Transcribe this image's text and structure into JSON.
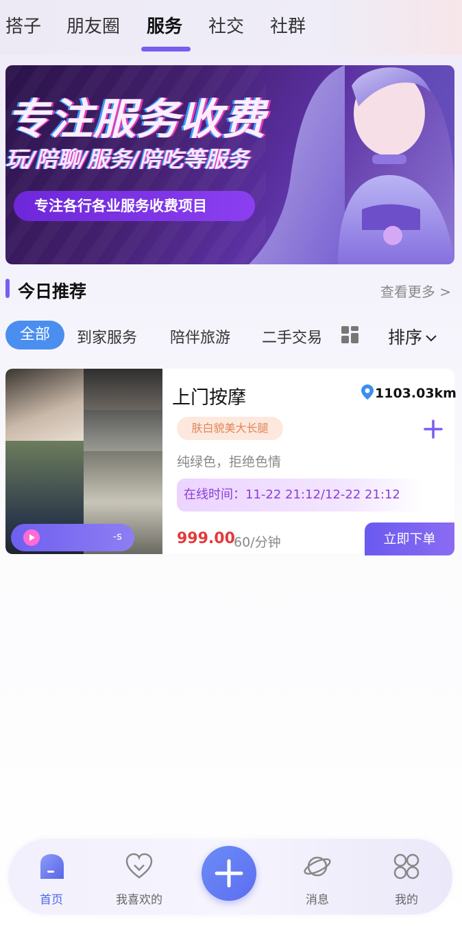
{
  "top_tabs": {
    "items": [
      {
        "label": "搭子"
      },
      {
        "label": "朋友圈"
      },
      {
        "label": "服务"
      },
      {
        "label": "社交"
      },
      {
        "label": "社群"
      }
    ],
    "active": "服务"
  },
  "banner": {
    "headline": "专注服务收费",
    "subline": "玩/陪聊/服务/陪吃等服务",
    "pill": "专注各行各业服务收费项目"
  },
  "section": {
    "title": "今日推荐",
    "see_more": "查看更多 >"
  },
  "categories": {
    "items": [
      {
        "label": "全部"
      },
      {
        "label": "到家服务"
      },
      {
        "label": "陪伴旅游"
      },
      {
        "label": "二手交易"
      }
    ],
    "active": "全部",
    "sort_label": "排序",
    "grid_icon": "grid-icon",
    "sort_icon": "chevron-down-icon"
  },
  "card": {
    "title": "上门按摩",
    "distance": "1103.03km",
    "tag": "肤白貌美大长腿",
    "description": "纯绿色，拒绝色情",
    "online_time": "在线时间：11-22 21:12/12-22 21:12",
    "price": "999.00",
    "unit": "60/分钟",
    "order_button": "立即下单",
    "audio_length": "-s"
  },
  "bottom_nav": {
    "items": [
      {
        "label": "首页",
        "icon": "home-icon",
        "active": true
      },
      {
        "label": "我喜欢的",
        "icon": "heart-icon"
      },
      {
        "label": "消息",
        "icon": "planet-icon"
      },
      {
        "label": "我的",
        "icon": "apps-icon"
      }
    ],
    "center_icon": "plus-icon"
  },
  "colors": {
    "accent": "#7a5cf0",
    "active_chip": "#4a8ef0",
    "price": "#e23b3b",
    "nav_active": "#4a68e6"
  }
}
